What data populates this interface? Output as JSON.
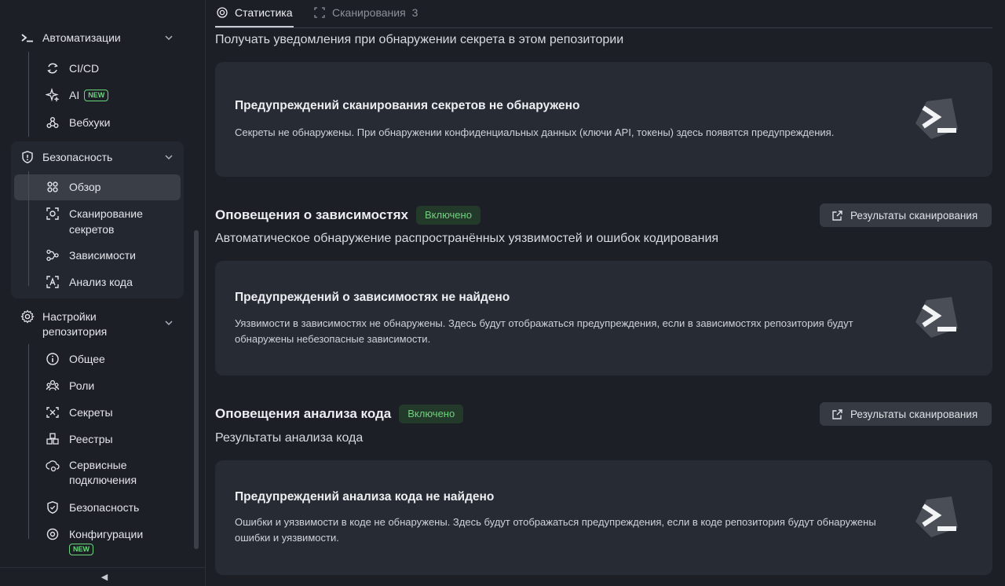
{
  "sidebar": {
    "automation": {
      "title": "Автоматизации",
      "items": [
        {
          "label": "CI/CD",
          "icon": "cicd-icon"
        },
        {
          "label": "AI",
          "icon": "sparkle-icon",
          "badge": "NEW"
        },
        {
          "label": "Вебхуки",
          "icon": "webhook-icon"
        }
      ]
    },
    "security": {
      "title": "Безопасность",
      "items": [
        {
          "label": "Обзор",
          "icon": "grid-icon",
          "active": true
        },
        {
          "label": "Сканирование секретов",
          "icon": "scan-icon"
        },
        {
          "label": "Зависимости",
          "icon": "dependencies-icon"
        },
        {
          "label": "Анализ кода",
          "icon": "code-analysis-icon"
        }
      ]
    },
    "settings": {
      "title": "Настройки репозитория",
      "items": [
        {
          "label": "Общее",
          "icon": "info-icon"
        },
        {
          "label": "Роли",
          "icon": "roles-icon"
        },
        {
          "label": "Секреты",
          "icon": "secrets-icon"
        },
        {
          "label": "Реестры",
          "icon": "registry-icon"
        },
        {
          "label": "Сервисные подключения",
          "icon": "service-connection-icon"
        },
        {
          "label": "Безопасность",
          "icon": "shield-icon"
        },
        {
          "label": "Конфигурации",
          "icon": "config-icon",
          "badge": "NEW"
        }
      ]
    },
    "collapse_glyph": "◀"
  },
  "tabs": [
    {
      "label": "Статистика",
      "active": true
    },
    {
      "label": "Сканирования",
      "count": "3"
    }
  ],
  "secrets": {
    "description": "Получать уведомления при обнаружении секрета в этом репозитории",
    "card_title": "Предупреждений сканирования секретов не обнаружено",
    "card_text": "Секреты не обнаружены. При обнаружении конфиденциальных данных (ключи API, токены) здесь появятся предупреждения."
  },
  "dependencies": {
    "title": "Оповещения о зависимостях",
    "status": "Включено",
    "button": "Результаты сканирования",
    "description": "Автоматическое обнаружение распространённых уязвимостей и ошибок кодирования",
    "card_title": "Предупреждений о зависимостях не найдено",
    "card_text": "Уязвимости в зависимостях не обнаружены. Здесь будут отображаться предупреждения, если в зависимостях репозитория будут обнаружены небезопасные зависимости."
  },
  "code_analysis": {
    "title": "Оповещения анализа кода",
    "status": "Включено",
    "button": "Результаты сканирования",
    "description": "Результаты анализа кода",
    "card_title": "Предупреждений анализа кода не найдено",
    "card_text": "Ошибки и уязвимости в коде не обнаружены. Здесь будут отображаться предупреждения, если в коде репозитория будут обнаружены ошибки и уязвимости."
  },
  "colors": {
    "background": "#1c1f26",
    "card": "#272b33",
    "status_green": "#6fd27d",
    "active_item": "#3a3e46"
  }
}
